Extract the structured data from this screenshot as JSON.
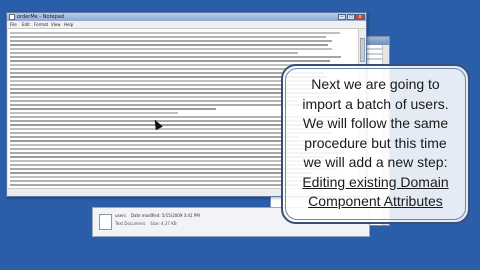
{
  "desktop": {
    "label": ""
  },
  "notepad": {
    "title": "orderMe - Notepad",
    "menu": [
      "File",
      "Edit",
      "Format",
      "View",
      "Help"
    ],
    "window_buttons": {
      "minimize": "–",
      "maximize": "□",
      "close": "x"
    }
  },
  "file_pane": {
    "file_name": "users",
    "file_meta": "Date modified: 5/15/2009 3:41 PM",
    "file_type": "Text Document",
    "file_size": "Size: 4.37 KB"
  },
  "callout": {
    "lines": [
      "Next we are going to",
      "import a batch of users.",
      "We will follow the same",
      "procedure but this time",
      "we will add a new step:"
    ],
    "highlight_lines": [
      "Editing existing Domain",
      "Component Attributes"
    ]
  },
  "colors": {
    "desktop": "#2b5ea8",
    "callout_border": "#394f77"
  }
}
